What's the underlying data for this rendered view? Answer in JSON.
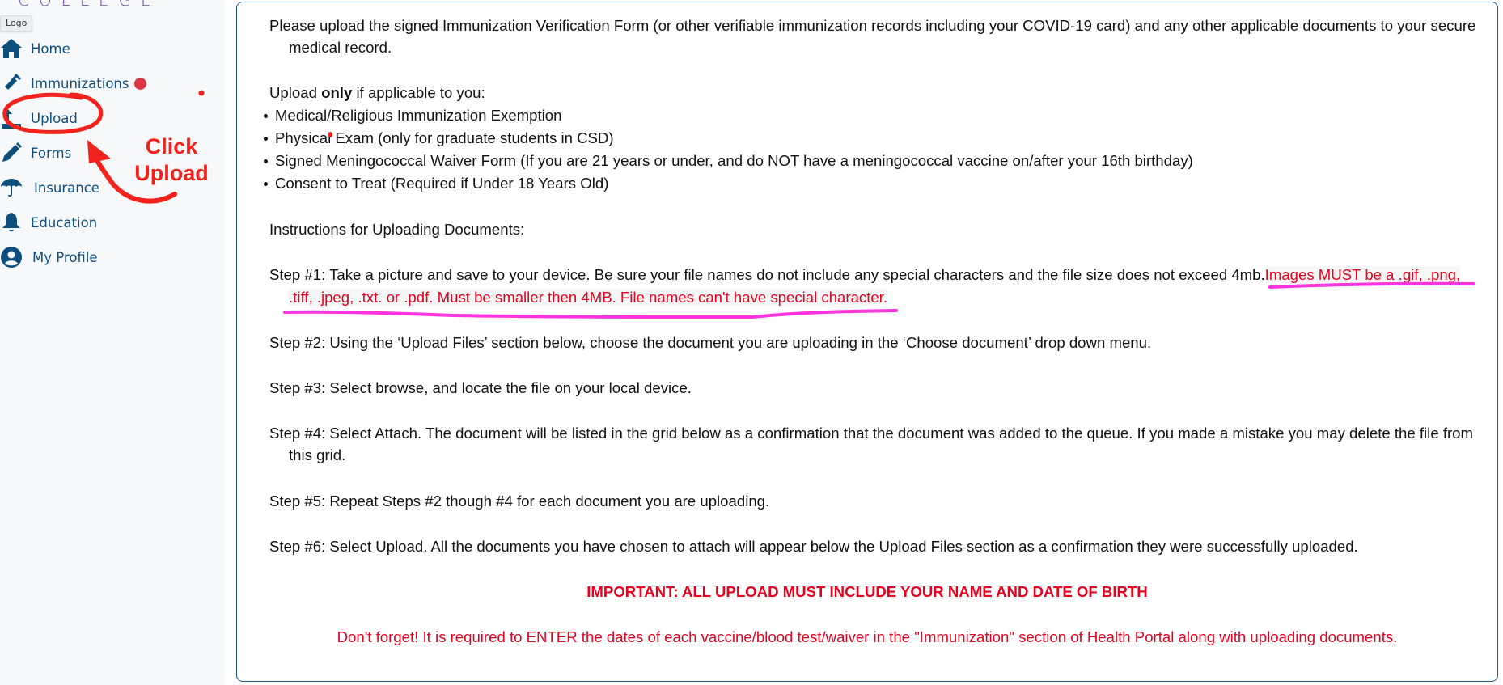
{
  "sidebar": {
    "logo_text": "COLLEGE",
    "logo_tooltip": "Logo",
    "items": [
      {
        "label": "Home",
        "icon": "home-icon"
      },
      {
        "label": "Immunizations",
        "icon": "syringe-icon",
        "has_alert_badge": true
      },
      {
        "label": "Upload",
        "icon": "upload-icon"
      },
      {
        "label": "Forms",
        "icon": "pencil-icon"
      },
      {
        "label": "Insurance",
        "icon": "umbrella-icon"
      },
      {
        "label": "Education",
        "icon": "bell-icon"
      },
      {
        "label": "My Profile",
        "icon": "user-circle-icon"
      }
    ]
  },
  "annotation": {
    "callout_line1": "Click",
    "callout_line2": "Upload",
    "color": "#f2231c",
    "underline_color": "#ff33e0"
  },
  "content": {
    "intro_line1": "Please upload the signed Immunization Verification Form (or other verifiable immunization records including your COVID-19 card) and any other applicable documents to your secure",
    "intro_line2": "medical record.",
    "upload_only_prefix": "Upload ",
    "upload_only_emph": "only",
    "upload_only_suffix": " if applicable to you:",
    "applicable_items": [
      "Medical/Religious Immunization Exemption",
      "Physical Exam (only for graduate students in CSD)",
      "Signed Meningococcal Waiver Form (If you are 21 years or under, and do NOT have a meningococcal vaccine on/after your 16th birthday)",
      "Consent to Treat (Required if Under 18 Years Old)"
    ],
    "instructions_heading": "Instructions for Uploading Documents:",
    "step1_line1": "Step #1: Take a picture and save to your device. Be sure your file names do not include any special characters and the file size does not exceed 4mb.",
    "step1_red_line1": "Images MUST be a .gif, .png,",
    "step1_red_line2": ".tiff, .jpeg, .txt. or .pdf. Must be smaller then 4MB. File names can't have special character.",
    "step2": "Step #2: Using the ‘Upload Files’ section below, choose the document you are uploading in the ‘Choose document’ drop down menu.",
    "step3": "Step #3: Select browse, and locate the file on your local device.",
    "step4_line1": "Step #4: Select Attach. The document will be listed in the grid below as a confirmation that the document was added to the queue. If you made a mistake you may delete the file from",
    "step4_line2": "this grid.",
    "step5": "Step #5: Repeat Steps #2 though #4 for each document you are uploading.",
    "step6": "Step #6: Select Upload. All the documents you have chosen to attach will appear below the Upload Files section as a confirmation they were successfully uploaded.",
    "important_prefix": "IMPORTANT: ",
    "important_emph": "ALL",
    "important_suffix": " UPLOAD MUST INCLUDE YOUR NAME AND DATE OF BIRTH",
    "reminder": "Don't forget! It is required to ENTER the dates of each vaccine/blood test/waiver in the \"Immunization\" section of Health Portal along with uploading documents."
  },
  "colors": {
    "nav_text": "#0d4f7c",
    "panel_border": "#1b5580",
    "warning_red": "#e8001f",
    "badge_red": "#dc3545"
  }
}
